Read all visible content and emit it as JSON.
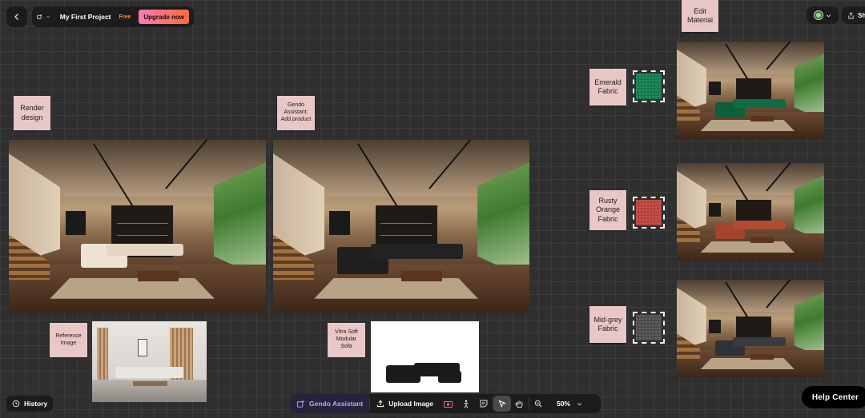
{
  "header": {
    "project_title": "My First Project",
    "plan_badge": "Free",
    "upgrade_label": "Upgrade now",
    "share_label": "Sh"
  },
  "notes": {
    "render_design": "Render design",
    "gendo_add_product": "Gendo Assistant: Add product",
    "reference_image": "Reference Image",
    "vitra_sofa": "Vitra Soft Modular Sofa",
    "edit_material": "Edit Material",
    "emerald_fabric": "Emerald Fabric",
    "rusty_orange_fabric": "Rusty Orange Fabric",
    "midgrey_fabric": "Mid-grey Fabric"
  },
  "swatch_colors": {
    "emerald": "#0f7a4a",
    "rusty_orange": "#b8403a",
    "midgrey": "#4a4a4a"
  },
  "sofa_colors": {
    "render": "#ece3d2",
    "add_product": "#1f1f1f",
    "emerald": "#0d5e3a",
    "rusty": "#a4442c",
    "grey": "#2f3338"
  },
  "bottom": {
    "history_label": "History",
    "assistant_label": "Gendo Assistant",
    "upload_label": "Upload Image",
    "zoom_value": "50%",
    "help_label": "Help Center"
  }
}
